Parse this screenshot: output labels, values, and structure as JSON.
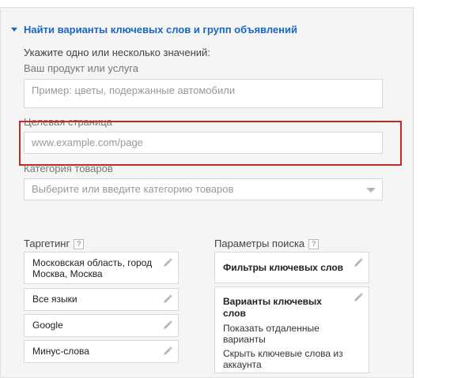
{
  "header": {
    "title": "Найти варианты ключевых слов и групп объявлений"
  },
  "form": {
    "instructions": "Укажите одно или несколько значений:",
    "product_label": "Ваш продукт или услуга",
    "product_placeholder": "Пример: цветы, подержанные автомобили",
    "landing_label": "Целевая страница",
    "landing_placeholder": "www.example.com/page",
    "category_label": "Категория товаров",
    "category_placeholder": "Выберите или введите категорию товаров"
  },
  "targeting": {
    "title": "Таргетинг",
    "help": "?",
    "items": [
      "Московская область, город Москва, Москва",
      "Все языки",
      "Google",
      "Минус-слова"
    ]
  },
  "search_params": {
    "title": "Параметры поиска",
    "help": "?",
    "filters_label": "Фильтры ключевых слов",
    "variants_label": "Варианты ключевых слов",
    "variant_options": [
      "Показать отдаленные варианты",
      "Скрыть ключевые слова из аккаунта"
    ]
  },
  "colors": {
    "accent": "#1a66c2",
    "highlight": "#c62828"
  },
  "icons": {
    "collapse": "triangle-down-icon",
    "edit": "pencil-icon",
    "dropdown": "chevron-down-icon"
  }
}
